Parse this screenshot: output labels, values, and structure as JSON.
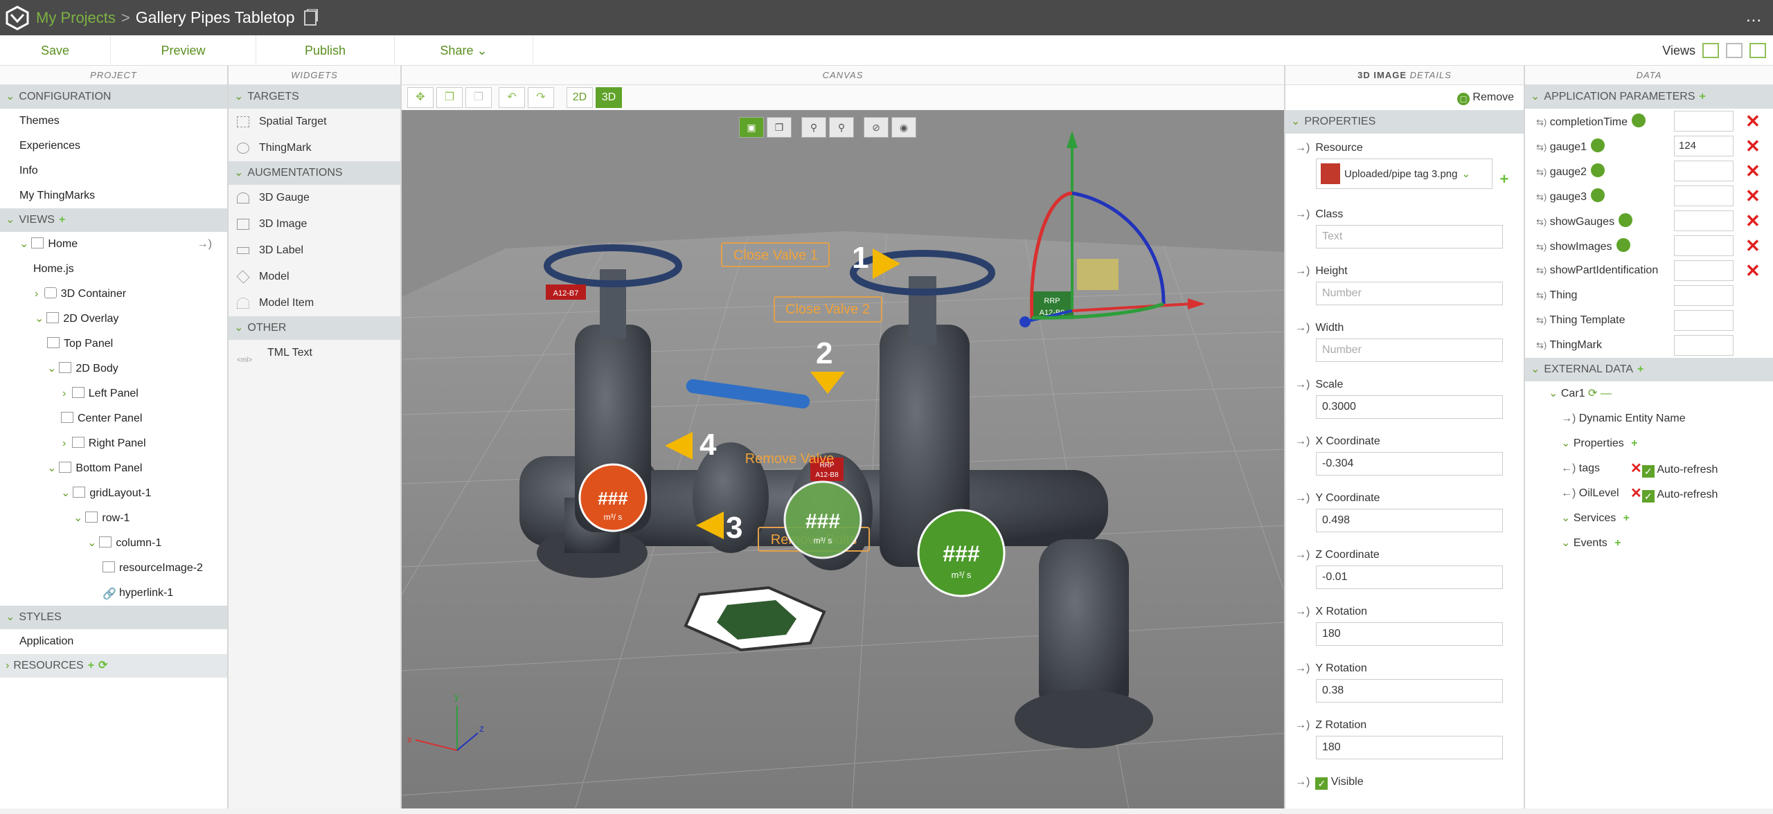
{
  "app": {
    "breadcrumb_root": "My Projects",
    "breadcrumb_sep": ">",
    "project_title": "Gallery Pipes Tabletop",
    "more": "..."
  },
  "toolbar": {
    "save": "Save",
    "preview": "Preview",
    "publish": "Publish",
    "share": "Share",
    "views": "Views"
  },
  "project": {
    "header": "PROJECT",
    "configuration": "CONFIGURATION",
    "config_items": [
      "Themes",
      "Experiences",
      "Info",
      "My ThingMarks"
    ],
    "views_label": "VIEWS",
    "tree": {
      "home": "Home",
      "homejs": "Home.js",
      "container3d": "3D Container",
      "overlay2d": "2D Overlay",
      "top_panel": "Top Panel",
      "body2d": "2D Body",
      "left_panel": "Left Panel",
      "center_panel": "Center Panel",
      "right_panel": "Right Panel",
      "bottom_panel": "Bottom Panel",
      "grid": "gridLayout-1",
      "row": "row-1",
      "column": "column-1",
      "resimg": "resourceImage-2",
      "hyper": "hyperlink-1"
    },
    "styles": "STYLES",
    "application": "Application",
    "resources": "RESOURCES"
  },
  "widgets": {
    "header": "WIDGETS",
    "targets": "TARGETS",
    "spatial": "Spatial Target",
    "thingmark": "ThingMark",
    "augmentations": "AUGMENTATIONS",
    "gauge": "3D Gauge",
    "image": "3D Image",
    "label": "3D Label",
    "model": "Model",
    "model_item": "Model Item",
    "other": "OTHER",
    "tml": "TML Text"
  },
  "canvas": {
    "header": "CANVAS",
    "btn2d": "2D",
    "btn3d": "3D",
    "labels": {
      "v1": "Close Valve 1",
      "v2": "Close Valve 2",
      "rv": "Remove Valve",
      "rb": "Remove Bolts",
      "n1": "1",
      "n2": "2",
      "n3": "3",
      "n4": "4",
      "tag1": "A12-B7",
      "tag2": "A12-B9",
      "tag3": "A12-B8",
      "rrp": "RRP",
      "hash": "###",
      "unit": "m³/ s"
    },
    "axes": {
      "y": "y",
      "z": "z",
      "x": "x"
    }
  },
  "details": {
    "header_bold": "3D IMAGE",
    "header_rest": "DETAILS",
    "remove": "Remove",
    "properties": "PROPERTIES",
    "resource_label": "Resource",
    "resource_value": "Uploaded/pipe tag 3.png",
    "fields": [
      {
        "label": "Class",
        "value": "",
        "placeholder": "Text"
      },
      {
        "label": "Height",
        "value": "",
        "placeholder": "Number"
      },
      {
        "label": "Width",
        "value": "",
        "placeholder": "Number"
      },
      {
        "label": "Scale",
        "value": "0.3000",
        "placeholder": ""
      },
      {
        "label": "X Coordinate",
        "value": "-0.304",
        "placeholder": ""
      },
      {
        "label": "Y Coordinate",
        "value": "0.498",
        "placeholder": ""
      },
      {
        "label": "Z Coordinate",
        "value": "-0.01",
        "placeholder": ""
      },
      {
        "label": "X Rotation",
        "value": "180",
        "placeholder": ""
      },
      {
        "label": "Y Rotation",
        "value": "0.38",
        "placeholder": ""
      },
      {
        "label": "Z Rotation",
        "value": "180",
        "placeholder": ""
      }
    ],
    "visible": "Visible"
  },
  "data": {
    "header": "DATA",
    "app_params": "APPLICATION PARAMETERS",
    "params": [
      {
        "name": "completionTime",
        "value": ""
      },
      {
        "name": "gauge1",
        "value": "124"
      },
      {
        "name": "gauge2",
        "value": ""
      },
      {
        "name": "gauge3",
        "value": ""
      },
      {
        "name": "showGauges",
        "value": ""
      },
      {
        "name": "showImages",
        "value": ""
      },
      {
        "name": "showPartIdentification",
        "value": ""
      },
      {
        "name": "Thing",
        "value": ""
      },
      {
        "name": "Thing Template",
        "value": ""
      },
      {
        "name": "ThingMark",
        "value": ""
      }
    ],
    "external": "EXTERNAL DATA",
    "car": "Car1",
    "dyn": "Dynamic Entity Name",
    "props": "Properties",
    "tags": "tags",
    "oil": "OilLevel",
    "autorefresh": "Auto-refresh",
    "services": "Services",
    "events": "Events"
  },
  "colors": {
    "accent": "#5fa32a",
    "remove": "#e02020",
    "titlebar": "#4a4a4a"
  }
}
